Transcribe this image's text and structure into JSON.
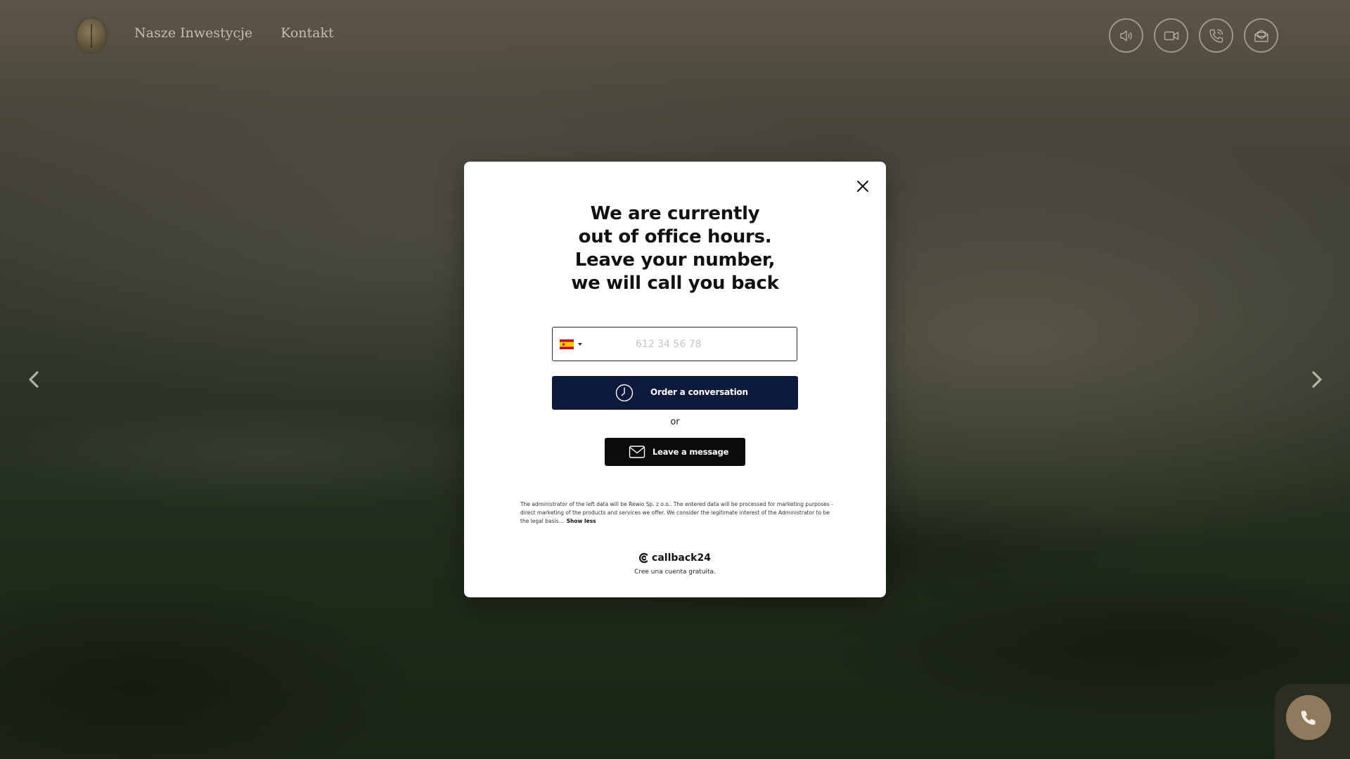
{
  "header": {
    "nav": [
      "Nasze Inwestycje",
      "Kontakt"
    ],
    "icons": [
      "speaker-icon",
      "video-icon",
      "phone-call-icon",
      "mail-icon"
    ]
  },
  "carousel": {
    "prev_icon": "chevron-left-icon",
    "next_icon": "chevron-right-icon"
  },
  "modal": {
    "headline": [
      "We are currently",
      "out of office hours.",
      "Leave your number,",
      "we will call you back"
    ],
    "phone": {
      "country": "ES",
      "value": "",
      "placeholder": "612 34 56 78"
    },
    "order_label": "Order a conversation",
    "or_text": "or",
    "message_label": "Leave a message",
    "legal_text": "The administrator of the left data will be Rewio Sp. z o.o.. The entered data will be processed for marketing purposes - direct marketing of the products and services we offer. We consider the legitimate interest of the Administrator to be the legal basis...",
    "show_less": "Show less",
    "brand_name": "callback24",
    "brand_sub": "Cree una cuenta gratuita."
  },
  "colors": {
    "order_button": "#0e1a3c",
    "message_button": "#0b0b0b",
    "float_button": "#8e7a5d"
  }
}
